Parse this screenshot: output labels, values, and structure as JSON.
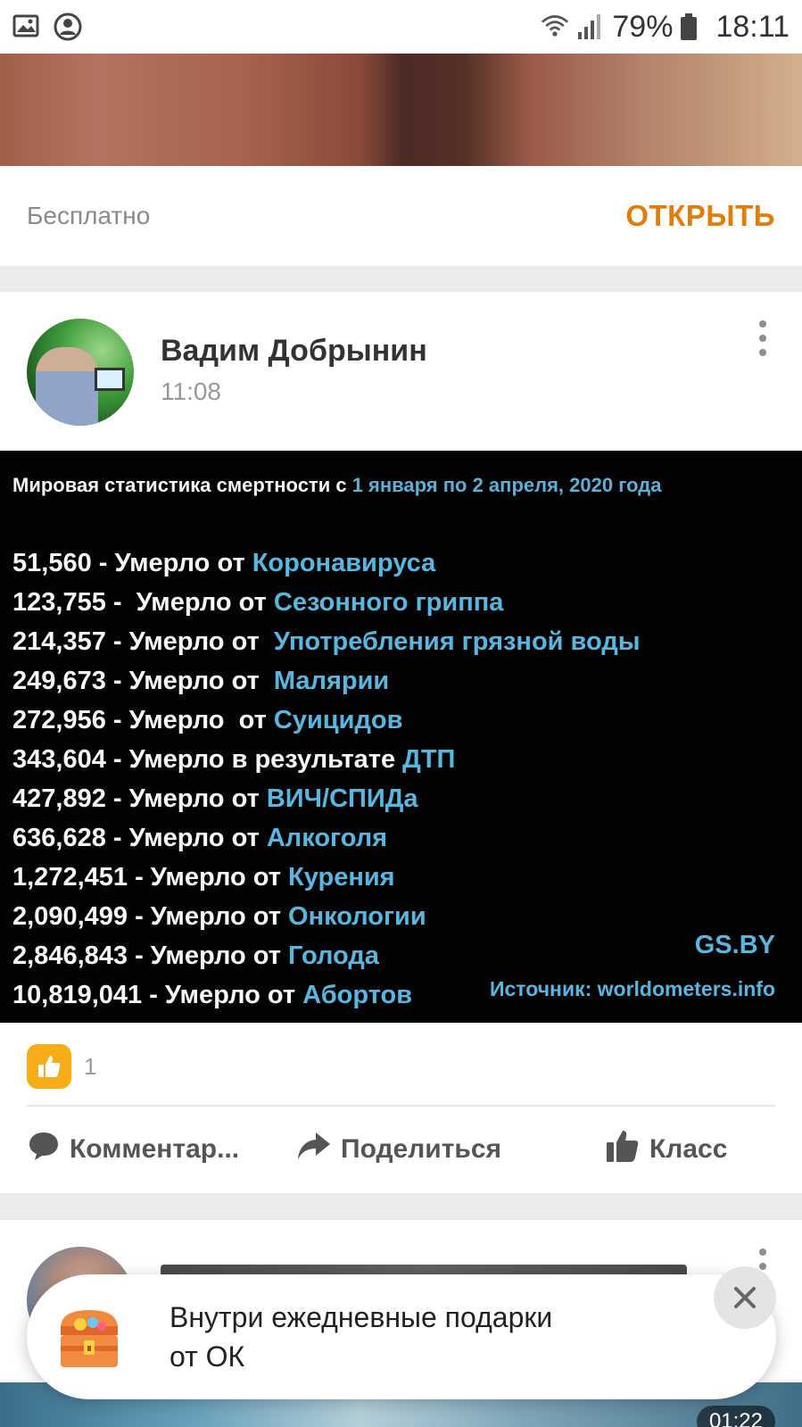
{
  "status_bar": {
    "battery": "79%",
    "time": "18:11",
    "icons": [
      "image-icon",
      "account-icon",
      "wifi-icon",
      "signal-icon",
      "battery-icon"
    ]
  },
  "ad": {
    "price_label": "Бесплатно",
    "open_button": "ОТКРЫТЬ",
    "accent_color": "#e27c0a"
  },
  "post": {
    "author": "Вадим Добрынин",
    "time": "11:08",
    "image": {
      "title_prefix": "Мировая статистика смертности с ",
      "title_range": "1 января по 2 апреля, 2020 года",
      "rows": [
        {
          "number": "51,560",
          "text": " - Умерло от ",
          "cause": "Коронавируса"
        },
        {
          "number": "123,755",
          "text": " -  Умерло от ",
          "cause": "Сезонного гриппа"
        },
        {
          "number": "214,357",
          "text": " - Умерло от  ",
          "cause": "Употребления грязной воды"
        },
        {
          "number": "249,673",
          "text": " - Умерло от  ",
          "cause": "Малярии"
        },
        {
          "number": "272,956",
          "text": " - Умерло  от ",
          "cause": "Суицидов"
        },
        {
          "number": "343,604",
          "text": " - Умерло в результате ",
          "cause": "ДТП"
        },
        {
          "number": "427,892",
          "text": " - Умерло от ",
          "cause": "ВИЧ/СПИДа"
        },
        {
          "number": "636,628",
          "text": " - Умерло от ",
          "cause": "Алкоголя"
        },
        {
          "number": "1,272,451",
          "text": " - Умерло от ",
          "cause": "Курения"
        },
        {
          "number": "2,090,499",
          "text": " - Умерло от ",
          "cause": "Онкологии"
        },
        {
          "number": "2,846,843",
          "text": " - Умерло от ",
          "cause": "Голода"
        },
        {
          "number": "10,819,041",
          "text": " - Умерло от ",
          "cause": "Абортов"
        }
      ],
      "brand": "GS.BY",
      "source": "Источник: worldometers.info"
    },
    "likes_count": "1",
    "actions": {
      "comment": "Комментар...",
      "share": "Поделиться",
      "klass": "Класс"
    }
  },
  "next_post": {
    "video_duration": "01:22"
  },
  "toast": {
    "message_line1": "Внутри ежедневные подарки",
    "message_line2": "от ОК"
  }
}
